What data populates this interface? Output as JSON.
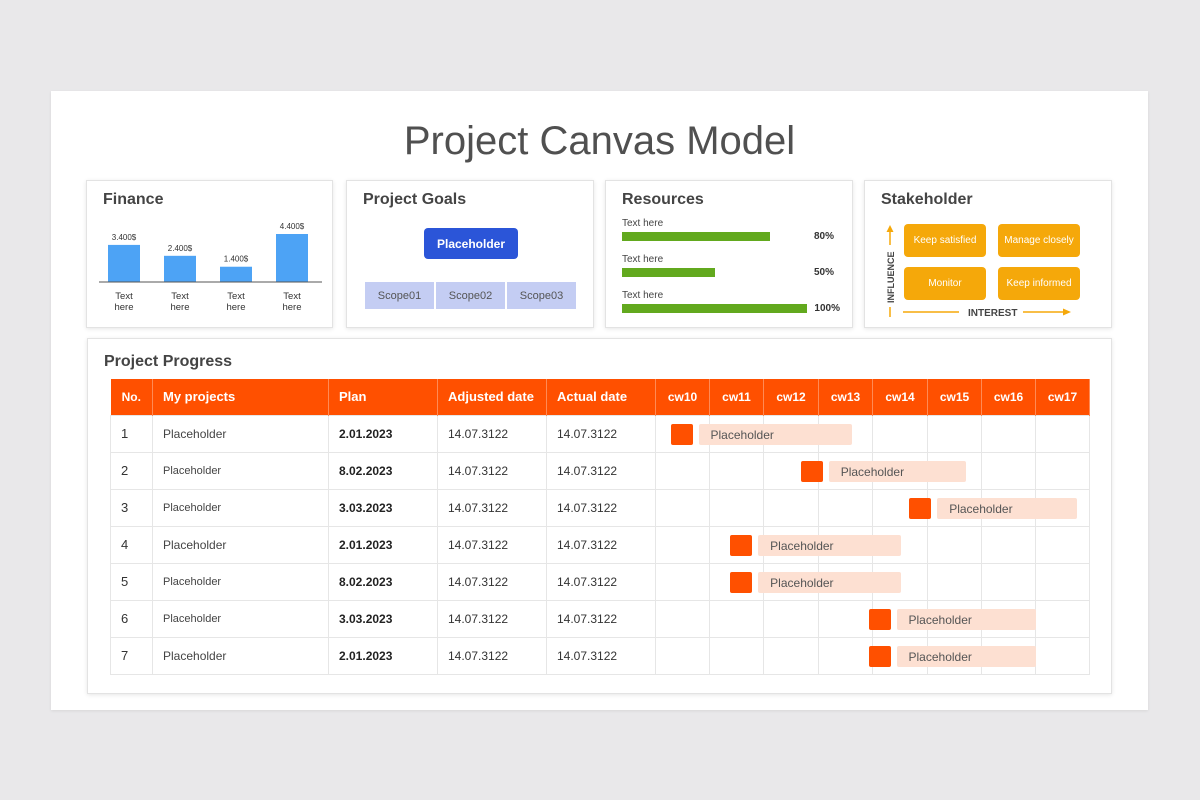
{
  "title": "Project Canvas Model",
  "finance": {
    "title": "Finance",
    "chart_data": {
      "type": "bar",
      "categories": [
        "Text here",
        "Text here",
        "Text here",
        "Text here"
      ],
      "values": [
        3400,
        2400,
        1400,
        4400
      ],
      "value_labels": [
        "3.400$",
        "2.400$",
        "1.400$",
        "4.400$"
      ],
      "ylim": [
        0,
        4400
      ],
      "color": "#4da3f5",
      "grid": false
    }
  },
  "goals": {
    "title": "Project Goals",
    "button": "Placeholder",
    "scopes": [
      "Scope01",
      "Scope02",
      "Scope03"
    ]
  },
  "resources": {
    "title": "Resources",
    "items": [
      {
        "label": "Text here",
        "percent_text": "80%",
        "value": 0.8
      },
      {
        "label": "Text here",
        "percent_text": "50%",
        "value": 0.5
      },
      {
        "label": "Text here",
        "percent_text": "100%",
        "value": 1.0
      }
    ],
    "bar_color": "#62a91e"
  },
  "stakeholder": {
    "title": "Stakeholder",
    "boxes": [
      "Keep satisfied",
      "Manage closely",
      "Monitor",
      "Keep informed"
    ],
    "y_axis": "INFLUENCE",
    "x_axis": "INTEREST",
    "accent": "#f5a80a"
  },
  "progress": {
    "title": "Project Progress",
    "headers": [
      "No.",
      "My projects",
      "Plan",
      "Adjusted date",
      "Actual date"
    ],
    "weeks": [
      "cw10",
      "cw11",
      "cw12",
      "cw13",
      "cw14",
      "cw15",
      "cw16",
      "cw17"
    ],
    "header_color": "#ff5000",
    "rows": [
      {
        "no": "1",
        "project": "Placeholder",
        "plan": "2.01.2023",
        "adjusted": "14.07.3122",
        "actual": "14.07.3122",
        "bar_label": "Placeholder",
        "start_week": 0,
        "end_week": 3.6
      },
      {
        "no": "2",
        "project": "Placeholder",
        "plan": "8.02.2023",
        "adjusted": "14.07.3122",
        "actual": "14.07.3122",
        "bar_label": "Placeholder",
        "start_week": 2.4,
        "end_week": 5.7
      },
      {
        "no": "3",
        "project": "Placeholder",
        "plan": "3.03.2023",
        "adjusted": "14.07.3122",
        "actual": "14.07.3122",
        "bar_label": "Placeholder",
        "start_week": 4.4,
        "end_week": 7.75
      },
      {
        "no": "4",
        "project": "Placeholder",
        "plan": "2.01.2023",
        "adjusted": "14.07.3122",
        "actual": "14.07.3122",
        "bar_label": "Placeholder",
        "start_week": 1.1,
        "end_week": 4.5
      },
      {
        "no": "5",
        "project": "Placeholder",
        "plan": "8.02.2023",
        "adjusted": "14.07.3122",
        "actual": "14.07.3122",
        "bar_label": "Placeholder",
        "start_week": 1.1,
        "end_week": 4.5
      },
      {
        "no": "6",
        "project": "Placeholder",
        "plan": "3.03.2023",
        "adjusted": "14.07.3122",
        "actual": "14.07.3122",
        "bar_label": "Placeholder",
        "start_week": 3.65,
        "end_week": 7.0
      },
      {
        "no": "7",
        "project": "Placeholder",
        "plan": "2.01.2023",
        "adjusted": "14.07.3122",
        "actual": "14.07.3122",
        "bar_label": "Placeholder",
        "start_week": 3.65,
        "end_week": 7.0
      }
    ]
  }
}
